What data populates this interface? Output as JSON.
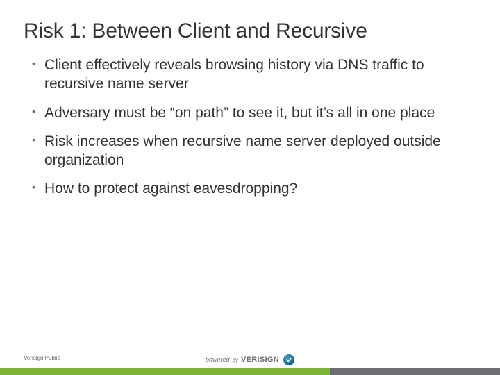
{
  "title": "Risk 1:  Between Client and Recursive",
  "bullets": [
    "Client effectively reveals browsing history via DNS traffic to recursive name server",
    "Adversary must be “on path” to see it, but it’s all in one place",
    "Risk increases when recursive name server deployed outside organization",
    "How to protect against eavesdropping?"
  ],
  "footer": {
    "classification": "Verisign Public",
    "powered_prefix": "powered",
    "powered_by": "by",
    "brand": "VERISIGN"
  },
  "colors": {
    "accent_green": "#7eb338",
    "accent_gray": "#6d6e71"
  }
}
